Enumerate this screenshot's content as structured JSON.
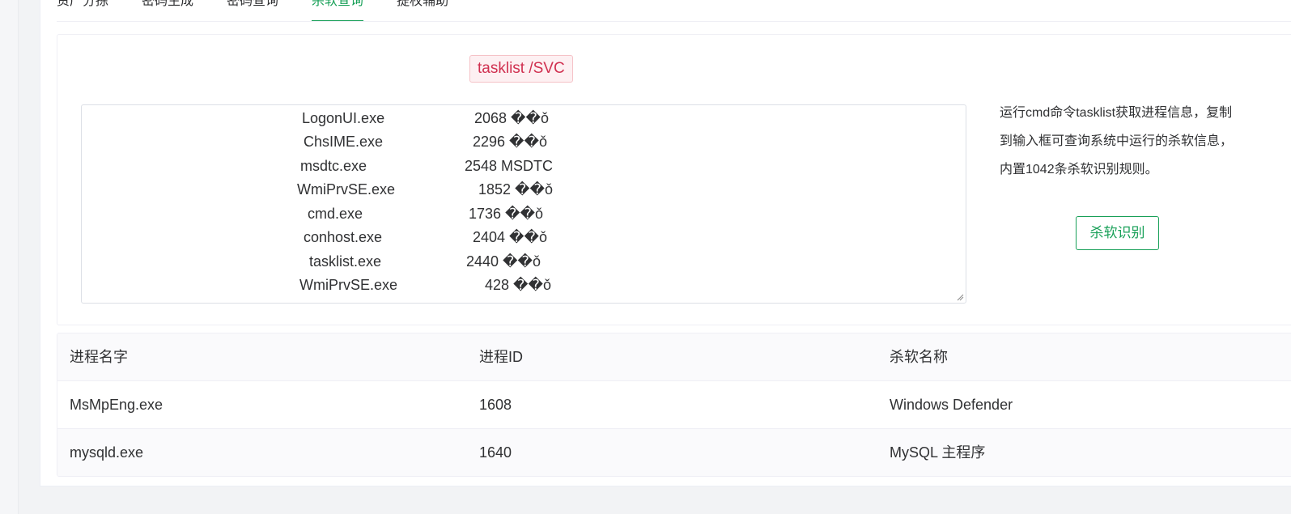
{
  "tabs": [
    {
      "label": "资产分拣",
      "active": false
    },
    {
      "label": "密码生成",
      "active": false
    },
    {
      "label": "密码查询",
      "active": false
    },
    {
      "label": "杀软查询",
      "active": true
    },
    {
      "label": "提权辅助",
      "active": false
    }
  ],
  "command_tag": "tasklist /SVC",
  "textarea_lines": [
    {
      "name": "LogonUI.exe",
      "pid": "2068 ��ǒ"
    },
    {
      "name": "ChsIME.exe",
      "pid": "2296 ��ǒ"
    },
    {
      "name": "msdtc.exe",
      "pid": "2548 MSDTC"
    },
    {
      "name": "WmiPrvSE.exe",
      "pid": "1852 ��ǒ"
    },
    {
      "name": "cmd.exe",
      "pid": "1736 ��ǒ"
    },
    {
      "name": "conhost.exe",
      "pid": "2404 ��ǒ"
    },
    {
      "name": "tasklist.exe",
      "pid": "2440 ��ǒ"
    },
    {
      "name": "WmiPrvSE.exe",
      "pid": "428 ��ǒ"
    }
  ],
  "help_lines": [
    "运行cmd命令tasklist获取进程信息，复制",
    "到输入框可查询系统中运行的杀软信息，",
    "内置1042条杀软识别规则。"
  ],
  "detect_button": "杀软识别",
  "table": {
    "headers": [
      "进程名字",
      "进程ID",
      "杀软名称"
    ],
    "rows": [
      [
        "MsMpEng.exe",
        "1608",
        "Windows Defender"
      ],
      [
        "mysqld.exe",
        "1640",
        "MySQL 主程序"
      ]
    ]
  },
  "colors": {
    "accent": "#18a058",
    "tag_text": "#d03050",
    "tag_bg": "#fdf0f2"
  }
}
